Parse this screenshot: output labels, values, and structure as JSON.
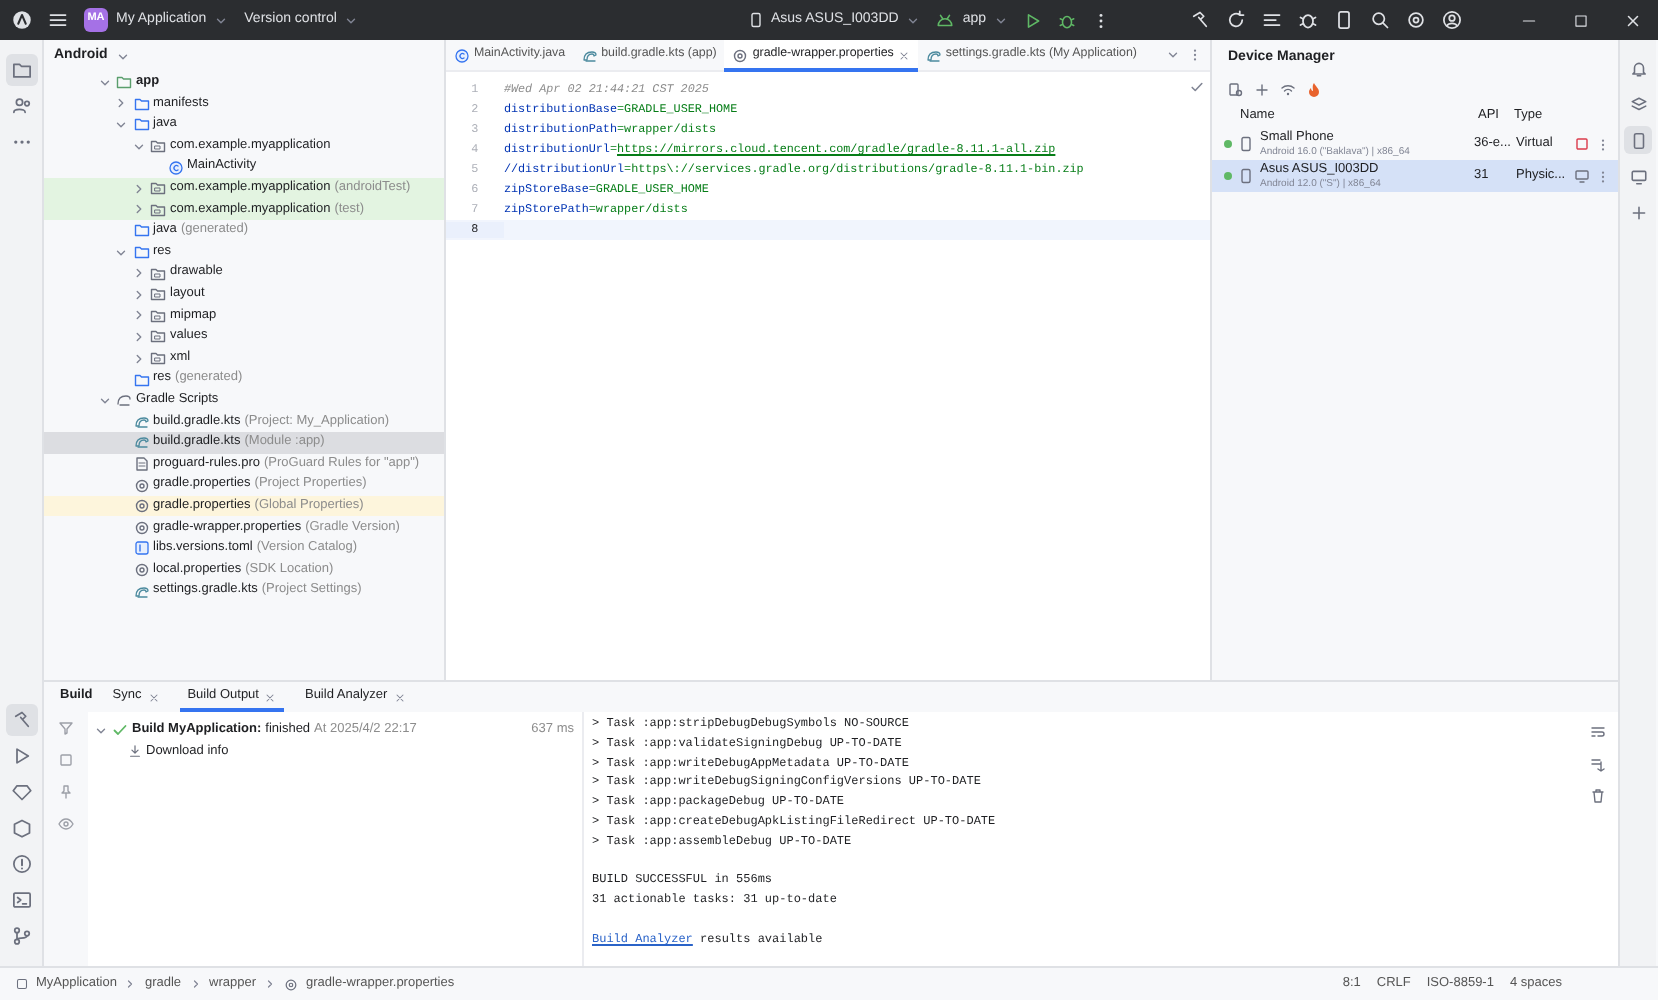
{
  "title_bar": {
    "avatar": "MA",
    "project": "My Application",
    "vcs": "Version control",
    "device": "Asus ASUS_I003DD",
    "run_config": "app"
  },
  "project_panel": {
    "view": "Android",
    "tree": [
      {
        "label": "app",
        "kind": "module",
        "selected": false,
        "expanded": true,
        "children": [
          {
            "label": "manifests",
            "kind": "folder",
            "selected": false,
            "expanded": false
          },
          {
            "label": "java",
            "kind": "folder",
            "selected": false,
            "expanded": true,
            "children": [
              {
                "label": "com.example.myapplication",
                "kind": "package",
                "selected": false,
                "expanded": true,
                "children": [
                  {
                    "label": "MainActivity",
                    "kind": "class",
                    "selected": false
                  }
                ]
              },
              {
                "label": "com.example.myapplication",
                "hint": "(androidTest)",
                "kind": "package",
                "selected": false,
                "expanded": false,
                "color": "#e3f4e1"
              },
              {
                "label": "com.example.myapplication",
                "hint": "(test)",
                "kind": "package",
                "selected": false,
                "expanded": false,
                "color": "#e3f4e1"
              }
            ]
          },
          {
            "label": "java",
            "hint": "(generated)",
            "kind": "folder",
            "selected": false
          },
          {
            "label": "res",
            "kind": "folder",
            "selected": false,
            "expanded": true,
            "children": [
              {
                "label": "drawable",
                "kind": "package",
                "selected": false,
                "expanded": false
              },
              {
                "label": "layout",
                "kind": "package",
                "selected": false,
                "expanded": false
              },
              {
                "label": "mipmap",
                "kind": "package",
                "selected": false,
                "expanded": false
              },
              {
                "label": "values",
                "kind": "package",
                "selected": false,
                "expanded": false
              },
              {
                "label": "xml",
                "kind": "package",
                "selected": false,
                "expanded": false
              }
            ]
          },
          {
            "label": "res",
            "hint": "(generated)",
            "kind": "folder",
            "selected": false
          }
        ]
      },
      {
        "label": "Gradle Scripts",
        "kind": "scripts",
        "selected": false,
        "expanded": true,
        "children": [
          {
            "label": "build.gradle.kts",
            "hint": "(Project: My_Application)",
            "kind": "gradle",
            "selected": false
          },
          {
            "label": "build.gradle.kts",
            "hint": "(Module :app)",
            "kind": "gradle",
            "selected": true
          },
          {
            "label": "proguard-rules.pro",
            "hint": "(ProGuard Rules for \"app\")",
            "kind": "file",
            "selected": false
          },
          {
            "label": "gradle.properties",
            "hint": "(Project Properties)",
            "kind": "props",
            "selected": false
          },
          {
            "label": "gradle.properties",
            "hint": "(Global Properties)",
            "kind": "props",
            "selected": false,
            "color": "#fdf5dc"
          },
          {
            "label": "gradle-wrapper.properties",
            "hint": "(Gradle Version)",
            "kind": "props",
            "selected": false
          },
          {
            "label": "libs.versions.toml",
            "hint": "(Version Catalog)",
            "kind": "toml",
            "selected": false
          },
          {
            "label": "local.properties",
            "hint": "(SDK Location)",
            "kind": "props",
            "selected": false
          },
          {
            "label": "settings.gradle.kts",
            "hint": "(Project Settings)",
            "kind": "gradle",
            "selected": false
          }
        ]
      }
    ]
  },
  "editor": {
    "tabs": [
      {
        "label": "MainActivity.java",
        "kind": "class",
        "selected": false
      },
      {
        "label": "build.gradle.kts (app)",
        "kind": "gradle",
        "selected": false
      },
      {
        "label": "gradle-wrapper.properties",
        "kind": "props",
        "selected": true
      },
      {
        "label": "settings.gradle.kts (My Application)",
        "kind": "gradle",
        "selected": false
      }
    ],
    "lines": [
      {
        "number": "1",
        "kind": "comment",
        "text": "#Wed Apr 02 21:44:21 CST 2025",
        "current": false
      },
      {
        "number": "2",
        "kind": "property",
        "key": "distributionBase",
        "sep": "=",
        "value": "GRADLE_USER_HOME",
        "link": false,
        "current": false
      },
      {
        "number": "3",
        "kind": "property",
        "key": "distributionPath",
        "sep": "=",
        "value": "wrapper/dists",
        "link": false,
        "current": false
      },
      {
        "number": "4",
        "kind": "property",
        "key": "distributionUrl",
        "sep": "=",
        "value": "https://mirrors.cloud.tencent.com/gradle/gradle-8.11.1-all.zip",
        "link": true,
        "current": false
      },
      {
        "number": "5",
        "kind": "property",
        "key": "//distributionUrl",
        "sep": "=",
        "value": "https\\://services.gradle.org/distributions/gradle-8.11.1-bin.zip",
        "link": false,
        "current": false
      },
      {
        "number": "6",
        "kind": "property",
        "key": "zipStoreBase",
        "sep": "=",
        "value": "GRADLE_USER_HOME",
        "link": false,
        "current": false
      },
      {
        "number": "7",
        "kind": "property",
        "key": "zipStorePath",
        "sep": "=",
        "value": "wrapper/dists",
        "link": false,
        "current": false
      },
      {
        "number": "8",
        "kind": "empty",
        "current": true
      }
    ]
  },
  "device_manager": {
    "title": "Device Manager",
    "columns": [
      "Name",
      "API",
      "Type"
    ],
    "devices": [
      {
        "name": "Small Phone",
        "detail": "Android 16.0 (\"Baklava\") | x86_64",
        "api": "36-e...",
        "type": "Virtual",
        "running": true,
        "selected": false,
        "kind": "stop"
      },
      {
        "name": "Asus ASUS_I003DD",
        "detail": "Android 12.0 (\"S\") | x86_64",
        "api": "31",
        "type": "Physic...",
        "running": true,
        "selected": true,
        "kind": "mirror"
      }
    ]
  },
  "build_panel": {
    "title": "Build",
    "tabs": [
      {
        "label": "Sync",
        "selected": false
      },
      {
        "label": "Build Output",
        "selected": true
      },
      {
        "label": "Build Analyzer",
        "selected": false
      }
    ],
    "tasks": [
      {
        "label": "Build MyApplication:",
        "status": "finished",
        "time_stamp": "At 2025/4/2 22:17",
        "duration": "637 ms",
        "success": true,
        "expanded": true,
        "children": [
          {
            "label": "Download info"
          }
        ]
      }
    ],
    "console": [
      [
        "> Task :app:stripDebugDebugSymbols NO-SOURCE",
        "> Task :app:validateSigningDebug UP-TO-DATE",
        "> Task :app:writeDebugAppMetadata UP-TO-DATE",
        "> Task :app:writeDebugSigningConfigVersions UP-TO-DATE",
        "> Task :app:packageDebug UP-TO-DATE",
        "> Task :app:createDebugApkListingFileRedirect UP-TO-DATE",
        "> Task :app:assembleDebug UP-TO-DATE"
      ],
      [
        "BUILD SUCCESSFUL in 556ms",
        "31 actionable tasks: 31 up-to-date"
      ]
    ],
    "analyzer": {
      "link": "Build Analyzer",
      "text": "results available"
    }
  },
  "status_bar": {
    "breadcrumbs": [
      "MyApplication",
      "gradle",
      "wrapper",
      "gradle-wrapper.properties"
    ],
    "position": "8:1",
    "line_separator": "CRLF",
    "encoding": "ISO-8859-1",
    "indent": "4 spaces"
  }
}
